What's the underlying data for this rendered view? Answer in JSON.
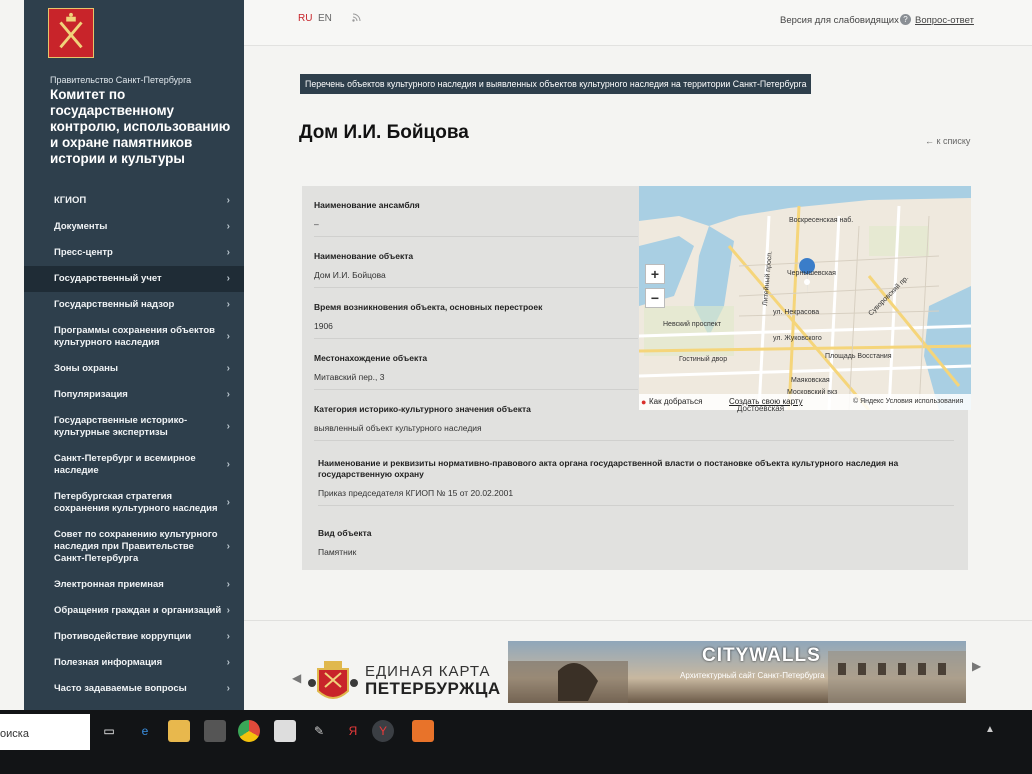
{
  "sidebar": {
    "government_label": "Правительство Санкт-Петербурга",
    "org_title": "Комитет по государственному контролю, использованию и охране памятников истории и культуры",
    "menu": [
      {
        "label": "КГИОП"
      },
      {
        "label": "Документы"
      },
      {
        "label": "Пресс-центр"
      },
      {
        "label": "Государственный учет",
        "active": true
      },
      {
        "label": "Государственный надзор"
      },
      {
        "label": "Программы сохранения объектов культурного наследия"
      },
      {
        "label": "Зоны охраны"
      },
      {
        "label": "Популяризация"
      },
      {
        "label": "Государственные историко-культурные экспертизы"
      },
      {
        "label": "Санкт-Петербург и всемирное наследие"
      },
      {
        "label": "Петербургская стратегия сохранения культурного наследия"
      },
      {
        "label": "Совет по сохранению культурного наследия при Правительстве Санкт-Петербурга"
      },
      {
        "label": "Электронная приемная"
      },
      {
        "label": "Обращения граждан и организаций"
      },
      {
        "label": "Противодействие коррупции"
      },
      {
        "label": "Полезная информация"
      },
      {
        "label": "Часто задаваемые вопросы"
      }
    ]
  },
  "topbar": {
    "lang_ru": "RU",
    "lang_en": "EN",
    "rss_icon": "rss-icon",
    "accessibility": "Версия для слабовидящих",
    "help_icon": "?",
    "faq": "Вопрос-ответ"
  },
  "breadcrumb": "Перечень объектов культурного наследия и выявленных объектов культурного наследия на территории Санкт-Петербурга",
  "page_title": "Дом И.И. Бойцова",
  "back_link": "← к списку",
  "fields": {
    "ensemble": {
      "label": "Наименование ансамбля",
      "value": "–"
    },
    "object_name": {
      "label": "Наименование объекта",
      "value": "Дом И.И. Бойцова"
    },
    "build_time": {
      "label": "Время возникновения объекта, основных перестроек",
      "value": "1906"
    },
    "location": {
      "label": "Местонахождение объекта",
      "value": "Митавский пер., 3"
    },
    "category": {
      "label": "Категория историко-культурного значения объекта",
      "value": "выявленный объект культурного наследия"
    },
    "legal_act": {
      "label": "Наименование и реквизиты нормативно-правового акта органа государственной власти о постановке объекта культурного наследия на государственную охрану",
      "value": "Приказ председателя КГИОП № 15 от 20.02.2001"
    },
    "object_type": {
      "label": "Вид объекта",
      "value": "Памятник"
    }
  },
  "map": {
    "zoom_in": "+",
    "zoom_out": "−",
    "route": "Как добраться",
    "create_map": "Создать свою карту",
    "copyright": "© Яндекс  Условия использования",
    "labels": {
      "l1": "Воскресенская наб.",
      "l2": "Чернышевская",
      "l3": "ул. Некрасова",
      "l4": "ул. Жуковского",
      "l5": "Невский проспект",
      "l6": "Гостиный двор",
      "l7": "Площадь Восстания",
      "l8": "Маяковская",
      "l9": "Московский вкз",
      "l10": "Литейный просп.",
      "l11": "Суворовский пр.",
      "l12": "Достоевская"
    }
  },
  "banners": {
    "card_line1": "ЕДИНАЯ КАРТА",
    "card_line2": "ПЕТЕРБУРЖЦА",
    "citywalls_title": "CITYWALLS",
    "citywalls_sub": "Архитектурный сайт Санкт-Петербурга"
  },
  "taskbar": {
    "search": "оиска"
  },
  "colors": {
    "sidebar": "#2e3f4c",
    "accent_red": "#c8242a"
  }
}
